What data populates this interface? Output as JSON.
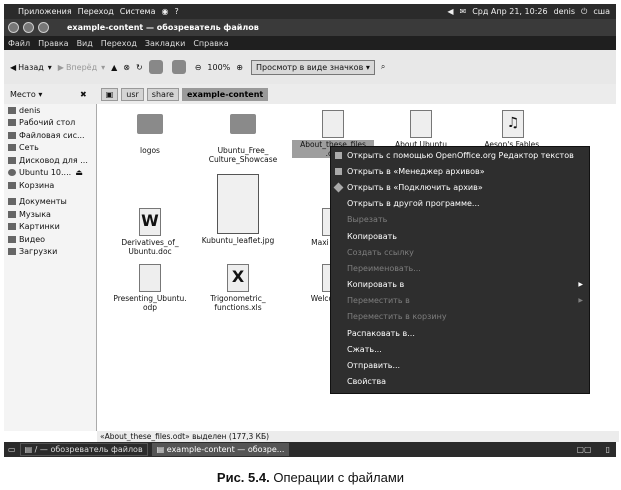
{
  "panel_top": {
    "applications": "Приложения",
    "places": "Переход",
    "system": "Система",
    "datetime": "Срд Апр 21, 10:26",
    "user": "denis",
    "keyboard": "сша"
  },
  "window": {
    "title": "example-content — обозреватель файлов"
  },
  "menubar": [
    "Файл",
    "Правка",
    "Вид",
    "Переход",
    "Закладки",
    "Справка"
  ],
  "toolbar": {
    "back": "Назад",
    "forward": "Вперёд",
    "zoom": "100%",
    "view_mode": "Просмотр в виде значков"
  },
  "location": {
    "places_label": "Место",
    "crumbs": [
      "usr",
      "share",
      "example-content"
    ]
  },
  "sidebar": {
    "items": [
      "denis",
      "Рабочий стол",
      "Файловая сис...",
      "Сеть",
      "Дисковод для ...",
      "Ubuntu 10....",
      "Корзина",
      "Документы",
      "Музыка",
      "Картинки",
      "Видео",
      "Загрузки"
    ]
  },
  "files": [
    {
      "name": "logos",
      "kind": "folder"
    },
    {
      "name": "Ubuntu_Free_ Culture_Showcase",
      "kind": "folder"
    },
    {
      "name": "About_these_files .odt",
      "kind": "doc"
    },
    {
      "name": "About Ubuntu",
      "kind": "doc"
    },
    {
      "name": "Aesop's Fables.",
      "kind": "audio"
    },
    {
      "name": "Derivatives_of_ Ubuntu.doc",
      "kind": "word"
    },
    {
      "name": "Kubuntu_leaflet.jpg",
      "kind": "image"
    },
    {
      "name": "Maxi equati",
      "kind": "doc"
    },
    {
      "name": "Presenting_Ubuntu. odp",
      "kind": "presentation"
    },
    {
      "name": "Trigonometric_ functions.xls",
      "kind": "spreadsheet"
    },
    {
      "name": "Welco Ubun",
      "kind": "doc"
    }
  ],
  "context_menu": [
    {
      "label": "Открыть с помощью OpenOffice.org Редактор текстов",
      "disabled": false,
      "icon": true
    },
    {
      "label": "Открыть в «Менеджер архивов»",
      "disabled": false,
      "icon": true
    },
    {
      "label": "Открыть в «Подключить архив»",
      "disabled": false,
      "icon": true
    },
    {
      "label": "Открыть в другой программе...",
      "disabled": false
    },
    {
      "label": "Вырезать",
      "disabled": true
    },
    {
      "label": "Копировать",
      "disabled": false
    },
    {
      "label": "Создать ссылку",
      "disabled": true
    },
    {
      "label": "Переименовать...",
      "disabled": true
    },
    {
      "label": "Копировать в",
      "disabled": false,
      "submenu": true
    },
    {
      "label": "Переместить в",
      "disabled": true,
      "submenu": true
    },
    {
      "label": "Переместить в корзину",
      "disabled": true
    },
    {
      "label": "Распаковать в...",
      "disabled": false
    },
    {
      "label": "Сжать...",
      "disabled": false
    },
    {
      "label": "Отправить...",
      "disabled": false
    },
    {
      "label": "Свойства",
      "disabled": false
    }
  ],
  "statusbar": {
    "text": "«About_these_files.odt» выделен (177,3 КБ)"
  },
  "panel_bottom": {
    "tasks": [
      "/ — обозреватель файлов",
      "example-content — обозре..."
    ]
  },
  "caption": {
    "number": "Рис. 5.4.",
    "text": " Операции с файлами"
  }
}
